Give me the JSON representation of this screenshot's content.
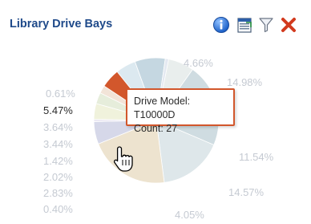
{
  "panel": {
    "title": "Library Drive Bays"
  },
  "toolbar": {
    "info_icon": "info-icon",
    "export_icon": "export-icon",
    "filter_icon": "filter-icon",
    "close_icon": "close-icon"
  },
  "colors": {
    "title": "#1f4a8a",
    "tooltip_border": "#d2572c",
    "highlight_slice": "#d2572c",
    "muted_label": "#c5cad2",
    "close": "#d23a1e"
  },
  "chart_data": {
    "type": "pie",
    "slices": [
      {
        "label": "4.66%",
        "value": 4.66,
        "color": "#e6ecea"
      },
      {
        "label": "14.98%",
        "value": 14.98,
        "color": "#c7d7dc"
      },
      {
        "label": "11.54%",
        "value": 11.54,
        "color": "#d9e3e7"
      },
      {
        "label": "14.57%",
        "value": 14.57,
        "color": "#eadfc7"
      },
      {
        "label": "4.05%",
        "value": 4.05,
        "color": "#cfd2e6"
      },
      {
        "label": "0.40%",
        "value": 0.4,
        "color": "#e7e3f0"
      },
      {
        "label": "2.83%",
        "value": 2.83,
        "color": "#eef0d6"
      },
      {
        "label": "2.02%",
        "value": 2.02,
        "color": "#e2ebd5"
      },
      {
        "label": "1.42%",
        "value": 1.42,
        "color": "#f0e0d2"
      },
      {
        "label": "3.44%",
        "value": 3.44,
        "color": "#d2572c"
      },
      {
        "label": "3.64%",
        "value": 3.64,
        "color": "#d7e6ee"
      },
      {
        "label": "5.47%",
        "value": 5.47,
        "color": "#bcd1dc"
      },
      {
        "label": "0.61%",
        "value": 0.61,
        "color": "#e0e6ef"
      }
    ],
    "highlighted_index": 9
  },
  "tooltip": {
    "line1": "Drive Model: T10000D",
    "line2": "Count: 27"
  }
}
